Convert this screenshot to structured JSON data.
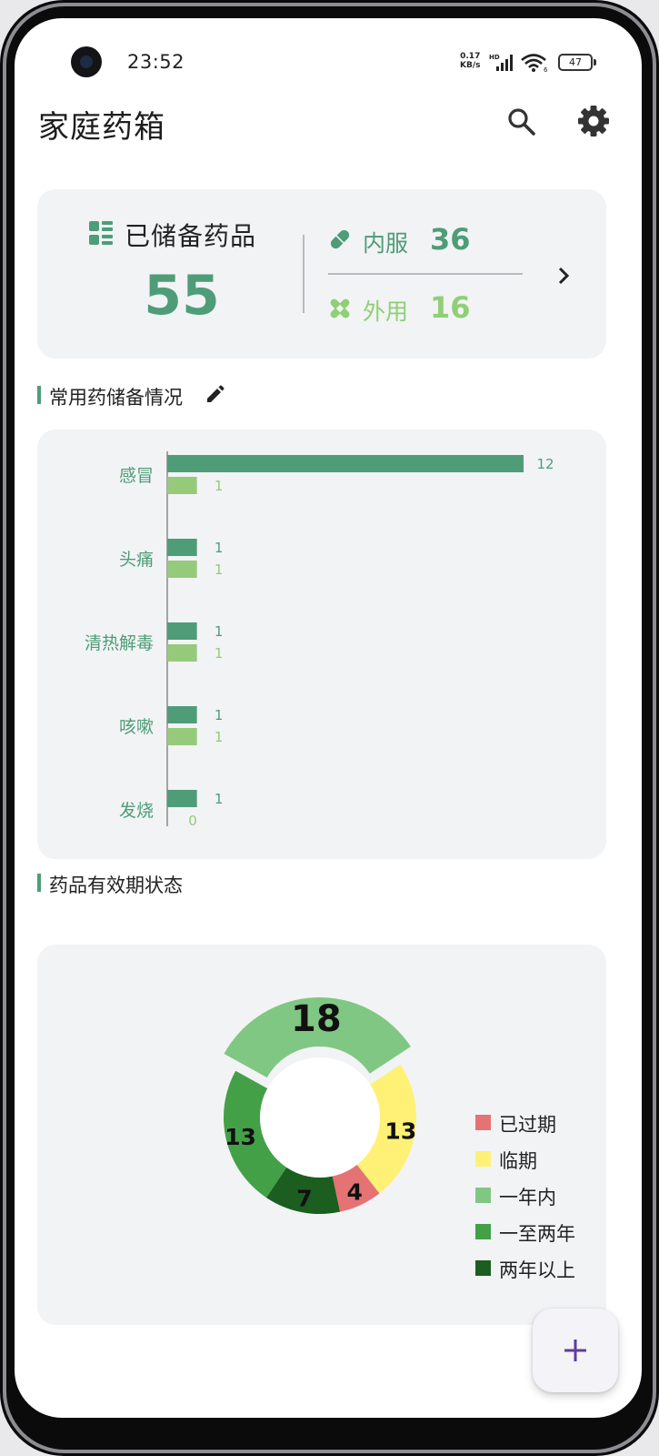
{
  "status_bar": {
    "time": "23:52",
    "net_speed_value": "0.17",
    "net_speed_unit": "KB/s",
    "battery": "47"
  },
  "header": {
    "title": "家庭药箱",
    "search_icon": "search-icon",
    "settings_icon": "gear-icon"
  },
  "summary": {
    "stock_label": "已储备药品",
    "stock_count": "55",
    "oral_label": "内服",
    "oral_count": "36",
    "external_label": "外用",
    "external_count": "16",
    "colors": {
      "oral": "#4e9d78",
      "external": "#8fcf76"
    }
  },
  "sections": {
    "common_title": "常用药储备情况",
    "validity_title": "药品有效期状态"
  },
  "chart_data": [
    {
      "type": "bar",
      "orientation": "horizontal",
      "categories": [
        "感冒",
        "头痛",
        "清热解毒",
        "咳嗽",
        "发烧"
      ],
      "series": [
        {
          "values": [
            12,
            1,
            1,
            1,
            1
          ],
          "color": "#4e9d78"
        },
        {
          "values": [
            1,
            1,
            1,
            1,
            0
          ],
          "color": "#95ca7b"
        }
      ],
      "xlim": [
        0,
        12
      ],
      "grid": false,
      "data_labels": true
    },
    {
      "type": "pie",
      "donut": true,
      "labels": [
        "已过期",
        "临期",
        "一年内",
        "一至两年",
        "两年以上"
      ],
      "values": [
        4,
        13,
        18,
        13,
        7
      ],
      "colors": [
        "#e57373",
        "#fff176",
        "#81c784",
        "#43a047",
        "#1b5e20"
      ],
      "legend_position": "right",
      "highlighted": "一年内"
    }
  ],
  "fab": {
    "icon": "plus-icon"
  }
}
